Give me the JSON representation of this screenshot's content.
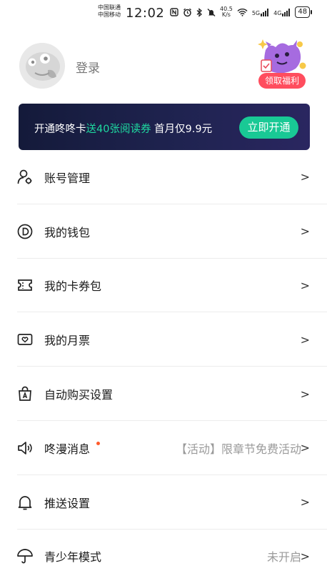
{
  "status_bar": {
    "carrier_1": "中国联通",
    "carrier_2": "中国移动",
    "time": "12:02",
    "net_speed_value": "40.5",
    "net_speed_unit": "K/s",
    "signal_1": "5G",
    "signal_2": "4G",
    "battery": "48"
  },
  "profile": {
    "login_label": "登录",
    "welfare_label": "领取福利"
  },
  "vip_banner": {
    "text_prefix": "开通咚咚卡",
    "text_highlight": "送40张阅读券",
    "text_suffix": " 首月仅9.9元",
    "button_label": "立即开通",
    "highlight_color": "#1ed9a0",
    "button_color": "#19c995"
  },
  "menu": {
    "items": [
      {
        "label": "账号管理",
        "icon": "account-manage-icon",
        "value": ""
      },
      {
        "label": "我的钱包",
        "icon": "wallet-icon",
        "value": ""
      },
      {
        "label": "我的卡券包",
        "icon": "coupon-icon",
        "value": ""
      },
      {
        "label": "我的月票",
        "icon": "monthly-ticket-icon",
        "value": ""
      },
      {
        "label": "自动购买设置",
        "icon": "auto-buy-icon",
        "value": ""
      },
      {
        "label": "咚漫消息",
        "icon": "speaker-icon",
        "value": "【活动】限章节免费活动"
      },
      {
        "label": "推送设置",
        "icon": "bell-icon",
        "value": ""
      },
      {
        "label": "青少年模式",
        "icon": "umbrella-icon",
        "value": "未开启"
      }
    ],
    "chevron": ">"
  }
}
